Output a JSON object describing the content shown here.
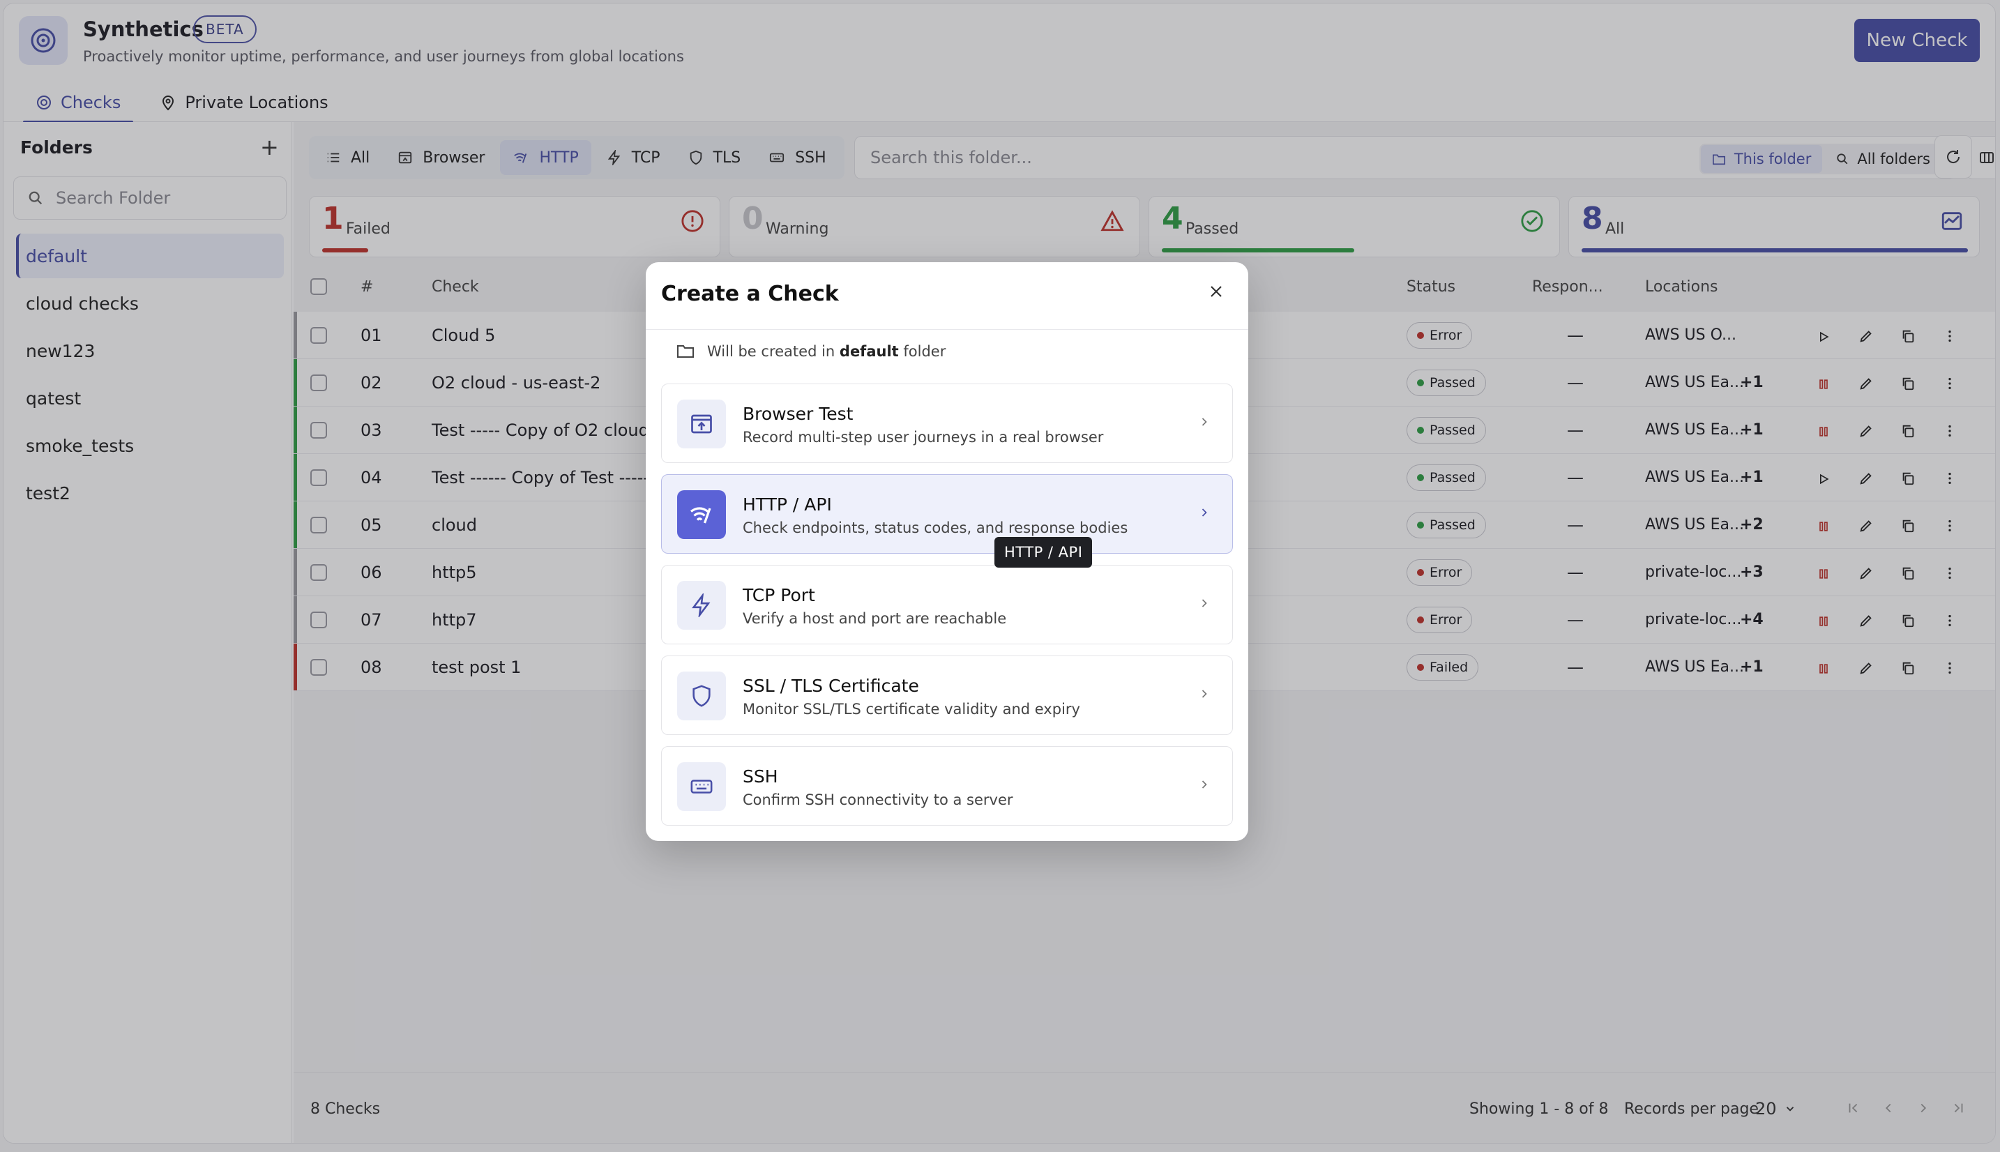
{
  "app": {
    "title": "Synthetics",
    "badge": "BETA",
    "subtitle": "Proactively monitor uptime, performance, and user journeys from global locations",
    "new_check_label": "New Check",
    "accent": "#474ea7"
  },
  "nav_tabs": [
    {
      "label": "Checks",
      "icon": "target-icon",
      "active": true
    },
    {
      "label": "Private Locations",
      "icon": "map-pin-icon",
      "active": false
    }
  ],
  "sidebar": {
    "title": "Folders",
    "search_placeholder": "Search Folder",
    "folders": [
      {
        "label": "default",
        "active": true
      },
      {
        "label": "cloud checks"
      },
      {
        "label": "new123"
      },
      {
        "label": "qatest"
      },
      {
        "label": "smoke_tests"
      },
      {
        "label": "test2"
      }
    ]
  },
  "filters": [
    {
      "label": "All",
      "icon": "list-icon"
    },
    {
      "label": "Browser",
      "icon": "browser-icon"
    },
    {
      "label": "HTTP",
      "icon": "wifi-icon",
      "active": true
    },
    {
      "label": "TCP",
      "icon": "bolt-icon"
    },
    {
      "label": "TLS",
      "icon": "shield-icon"
    },
    {
      "label": "SSH",
      "icon": "keyboard-icon"
    }
  ],
  "search": {
    "placeholder": "Search this folder...",
    "this_folder": "This folder",
    "all_folders": "All folders"
  },
  "stats": [
    {
      "value": "1",
      "label": "Failed",
      "color": "#c0322b",
      "fill": 0.11
    },
    {
      "value": "0",
      "label": "Warning",
      "color": "#c8c8cc",
      "fill": 0
    },
    {
      "value": "4",
      "label": "Passed",
      "color": "#2f9e44",
      "fill": 0.54
    },
    {
      "value": "8",
      "label": "All",
      "color": "#474ea7",
      "fill": 1
    }
  ],
  "table": {
    "headers": {
      "num": "#",
      "check": "Check",
      "status": "Status",
      "response": "Respon...",
      "locations": "Locations"
    },
    "rows": [
      {
        "num": "01",
        "name": "Cloud 5",
        "status": "Error",
        "response": "—",
        "location": "AWS US O...",
        "extra": "",
        "stripe": "#9a9aa0",
        "run": "play"
      },
      {
        "num": "02",
        "name": "O2 cloud - us-east-2",
        "status": "Passed",
        "response": "—",
        "location": "AWS US Ea...",
        "extra": "+1",
        "stripe": "#2f9e44",
        "run": "pause"
      },
      {
        "num": "03",
        "name": "Test ----- Copy of O2 cloud -",
        "status": "Passed",
        "response": "—",
        "location": "AWS US Ea...",
        "extra": "+1",
        "stripe": "#2f9e44",
        "run": "pause"
      },
      {
        "num": "04",
        "name": "Test ------ Copy of Test -----",
        "status": "Passed",
        "response": "—",
        "location": "AWS US Ea...",
        "extra": "+1",
        "stripe": "#2f9e44",
        "run": "play"
      },
      {
        "num": "05",
        "name": "cloud",
        "status": "Passed",
        "response": "—",
        "location": "AWS US Ea...",
        "extra": "+2",
        "stripe": "#2f9e44",
        "run": "pause"
      },
      {
        "num": "06",
        "name": "http5",
        "status": "Error",
        "response": "—",
        "location": "private-loc...",
        "extra": "+3",
        "stripe": "#9a9aa0",
        "run": "pause"
      },
      {
        "num": "07",
        "name": "http7",
        "status": "Error",
        "response": "—",
        "location": "private-loc...",
        "extra": "+4",
        "stripe": "#9a9aa0",
        "run": "pause"
      },
      {
        "num": "08",
        "name": "test post 1",
        "status": "Failed",
        "response": "—",
        "location": "AWS US Ea...",
        "extra": "+1",
        "stripe": "#c0322b",
        "run": "pause"
      }
    ]
  },
  "footer": {
    "count": "8 Checks",
    "showing": "Showing 1 - 8 of 8",
    "records_label": "Records per page",
    "records_value": "20"
  },
  "modal": {
    "title": "Create a Check",
    "note_prefix": "Will be created in",
    "note_folder": "default",
    "note_suffix": "folder",
    "options": [
      {
        "title": "Browser Test",
        "desc": "Record multi-step user journeys in a real browser",
        "icon": "browser-icon"
      },
      {
        "title": "HTTP / API",
        "desc": "Check endpoints, status codes, and response bodies",
        "icon": "wifi-icon",
        "active": true
      },
      {
        "title": "TCP Port",
        "desc": "Verify a host and port are reachable",
        "icon": "bolt-icon"
      },
      {
        "title": "SSL / TLS Certificate",
        "desc": "Monitor SSL/TLS certificate validity and expiry",
        "icon": "shield-icon"
      },
      {
        "title": "SSH",
        "desc": "Confirm SSH connectivity to a server",
        "icon": "keyboard-icon"
      }
    ],
    "tooltip": "HTTP / API"
  }
}
